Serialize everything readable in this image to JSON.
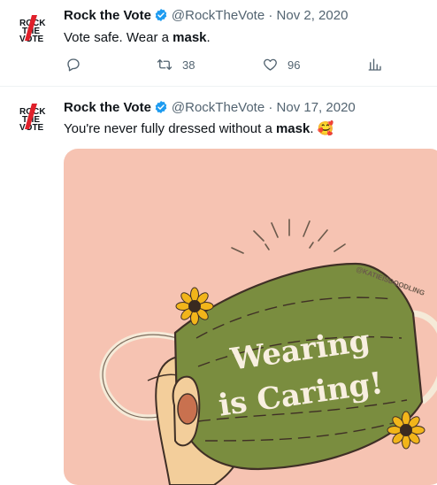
{
  "tweets": [
    {
      "name": "Rock the Vote",
      "handle": "@RockTheVote",
      "separator": "·",
      "date": "Nov 2, 2020",
      "text_before": "Vote safe. Wear a ",
      "text_bold": "mask",
      "text_after": ".",
      "retweets": "38",
      "likes": "96",
      "avatar_text": [
        "ROCK",
        "THE",
        "VOTE"
      ]
    },
    {
      "name": "Rock the Vote",
      "handle": "@RockTheVote",
      "separator": "·",
      "date": "Nov 17, 2020",
      "text_before": "You're never fully dressed without a ",
      "text_bold": "mask",
      "text_after": ". 🥰",
      "avatar_text": [
        "ROCK",
        "THE",
        "VOTE"
      ],
      "media": {
        "headline_line1": "Wearing",
        "headline_line2": "is Caring!",
        "credit": "@KATIEISDOODLING"
      }
    }
  ],
  "colors": {
    "verified": "#1d9bf0",
    "secondary_text": "#536471",
    "media_background": "#f6c3b2",
    "mask_green": "#7a8d3f",
    "logo_red": "#e0202a"
  },
  "icons": {
    "reply": "reply-icon",
    "retweet": "retweet-icon",
    "like": "heart-icon",
    "views": "analytics-icon",
    "verified": "verified-badge-icon"
  }
}
